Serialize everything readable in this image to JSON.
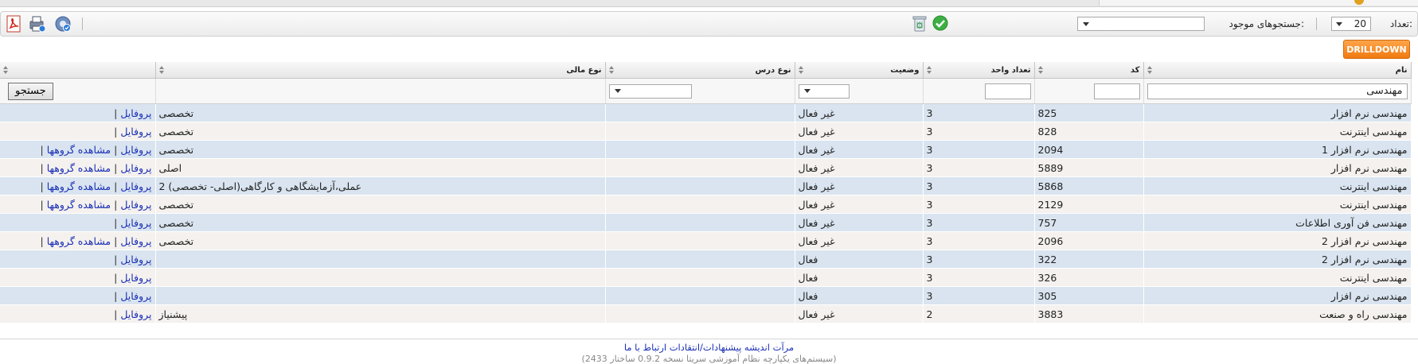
{
  "toolbar": {
    "count_label": "تعداد:",
    "count_value": "20",
    "saved_searches_label": "جستجوهای موجود:",
    "saved_searches_value": ""
  },
  "drilldown_label": "DRILLDOWN",
  "columns": {
    "name": "نام",
    "code": "کد",
    "units": "تعداد واحد",
    "status": "وضعیت",
    "course_type": "نوع درس",
    "financial_type": "نوع مالی"
  },
  "filters": {
    "name_value": "مهندسی",
    "search_button": "جستجو"
  },
  "links": {
    "profile": "پروفایل",
    "groups": "مشاهده گروهها",
    "separator": "|"
  },
  "rows": [
    {
      "name": "مهندسی نرم افزار",
      "code": "825",
      "units": "3",
      "status": "غیر فعال",
      "course_type": "",
      "financial_type": "تخصصی",
      "groups": false
    },
    {
      "name": "مهندسی اینترنت",
      "code": "828",
      "units": "3",
      "status": "غیر فعال",
      "course_type": "",
      "financial_type": "تخصصی",
      "groups": false
    },
    {
      "name": "مهندسی نرم افزار 1",
      "code": "2094",
      "units": "3",
      "status": "غیر فعال",
      "course_type": "",
      "financial_type": "تخصصی",
      "groups": true
    },
    {
      "name": "مهندسی نرم افزار",
      "code": "5889",
      "units": "3",
      "status": "غیر فعال",
      "course_type": "",
      "financial_type": "اصلی",
      "groups": true
    },
    {
      "name": "مهندسی اینترنت",
      "code": "5868",
      "units": "3",
      "status": "غیر فعال",
      "course_type": "",
      "financial_type": "عملی،آزمایشگاهی و کارگاهی(اصلی- تخصصی) 2",
      "groups": true
    },
    {
      "name": "مهندسی اینترنت",
      "code": "2129",
      "units": "3",
      "status": "غیر فعال",
      "course_type": "",
      "financial_type": "تخصصی",
      "groups": true
    },
    {
      "name": "مهندسی فن آوری اطلاعات",
      "code": "757",
      "units": "3",
      "status": "غیر فعال",
      "course_type": "",
      "financial_type": "تخصصی",
      "groups": false
    },
    {
      "name": "مهندسی نرم افزار 2",
      "code": "2096",
      "units": "3",
      "status": "غیر فعال",
      "course_type": "",
      "financial_type": "تخصصی",
      "groups": true
    },
    {
      "name": "مهندسی نرم افزار 2",
      "code": "322",
      "units": "3",
      "status": "فعال",
      "course_type": "",
      "financial_type": "",
      "groups": false
    },
    {
      "name": "مهندسی اینترنت",
      "code": "326",
      "units": "3",
      "status": "فعال",
      "course_type": "",
      "financial_type": "",
      "groups": false
    },
    {
      "name": "مهندسی نرم افزار",
      "code": "305",
      "units": "3",
      "status": "فعال",
      "course_type": "",
      "financial_type": "",
      "groups": false
    },
    {
      "name": "مهندسی راه و صنعت",
      "code": "3883",
      "units": "2",
      "status": "غیر فعال",
      "course_type": "",
      "financial_type": "پیشنیاز",
      "groups": false
    }
  ],
  "footer": {
    "links": "مرآت اندیشه پیشنهادات/انتقادات ارتباط با ما",
    "version": "(سیستم‌های یکپارچه نظام آموزشی سریتا نسخه 0.9.2 ساختار 2433)"
  }
}
